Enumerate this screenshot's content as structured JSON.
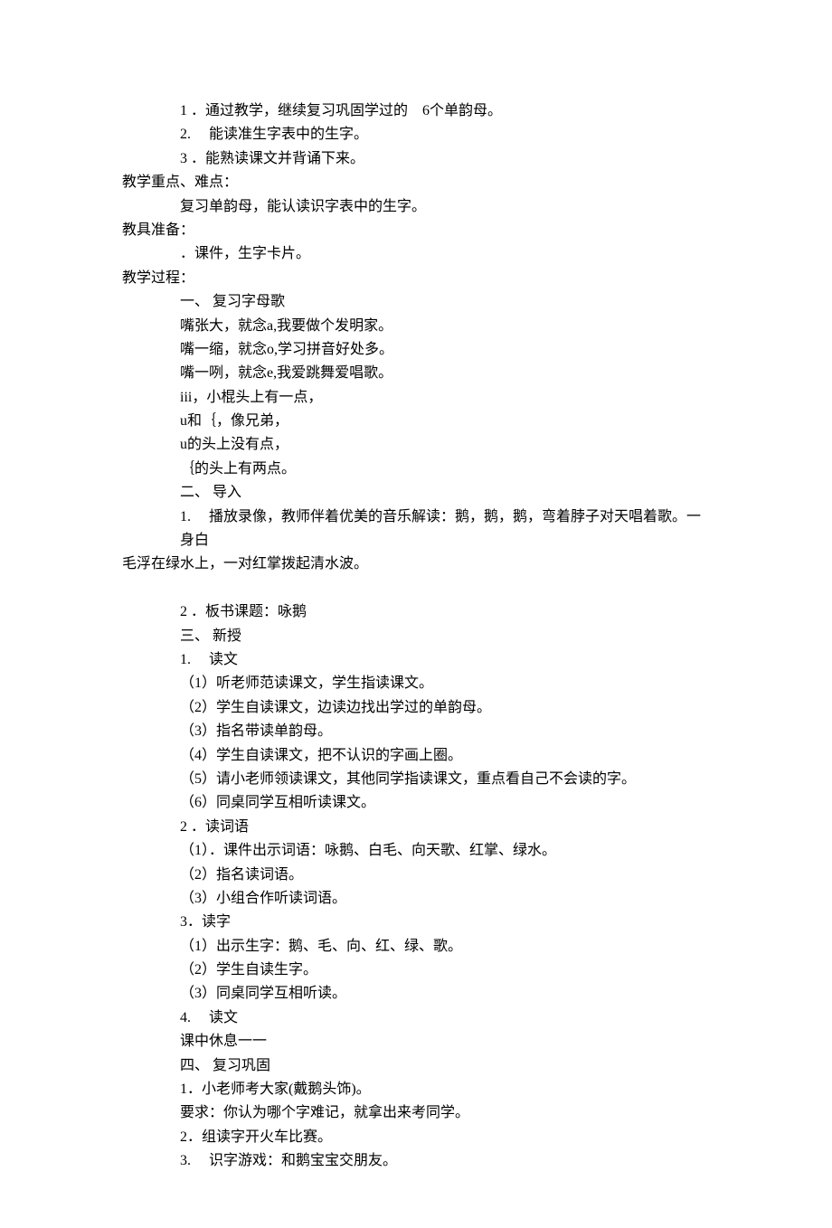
{
  "lines": [
    {
      "cls": "indent-2",
      "text": "1 ．通过教学，继续复习巩固学过的　6个单韵母。"
    },
    {
      "cls": "indent-2",
      "text": "2.　 能读准生字表中的生字。"
    },
    {
      "cls": "indent-2",
      "text": "3 ．能熟读课文并背诵下来。"
    },
    {
      "cls": "",
      "text": "教学重点、难点："
    },
    {
      "cls": "indent-2",
      "text": "复习单韵母，能认读识字表中的生字。"
    },
    {
      "cls": "",
      "text": "教具准备："
    },
    {
      "cls": "indent-2",
      "text": "．课件，生字卡片。"
    },
    {
      "cls": "",
      "text": "教学过程："
    },
    {
      "cls": "indent-2",
      "text": "一、 复习字母歌"
    },
    {
      "cls": "indent-2",
      "text": "嘴张大，就念a,我要做个发明家。"
    },
    {
      "cls": "indent-2",
      "text": "嘴一缩，就念o,学习拼音好处多。"
    },
    {
      "cls": "indent-2",
      "text": "嘴一咧，就念e,我爱跳舞爱唱歌。"
    },
    {
      "cls": "indent-2",
      "text": "iii，小棍头上有一点，"
    },
    {
      "cls": "indent-2",
      "text": "u和｛，像兄弟，"
    },
    {
      "cls": "indent-2",
      "text": "u的头上没有点，"
    },
    {
      "cls": "indent-2",
      "text": "｛的头上有两点。"
    },
    {
      "cls": "indent-2",
      "text": "二、 导入"
    },
    {
      "cls": "indent-2",
      "text": "1.　 播放录像，教师伴着优美的音乐解读：鹅，鹅，鹅，弯着脖子对天唱着歌。一身白"
    },
    {
      "cls": "",
      "text": "毛浮在绿水上，一对红掌拨起清水波。"
    },
    {
      "cls": "blank",
      "text": ""
    },
    {
      "cls": "indent-2",
      "text": "2 ．板书课题：咏鹅"
    },
    {
      "cls": "indent-2",
      "text": "三、 新授"
    },
    {
      "cls": "indent-2",
      "text": "1.　 读文"
    },
    {
      "cls": "indent-2",
      "text": "（1）听老师范读课文，学生指读课文。"
    },
    {
      "cls": "indent-2",
      "text": "（2）学生自读课文，边读边找出学过的单韵母。"
    },
    {
      "cls": "indent-2",
      "text": "（3）指名带读单韵母。"
    },
    {
      "cls": "indent-2",
      "text": "（4）学生自读课文，把不认识的字画上圈。"
    },
    {
      "cls": "indent-2",
      "text": "（5）请小老师领读课文，其他同学指读课文，重点看自己不会读的字。"
    },
    {
      "cls": "indent-2",
      "text": "（6）同桌同学互相听读课文。"
    },
    {
      "cls": "indent-2",
      "text": "2 ．读词语"
    },
    {
      "cls": "indent-2",
      "text": "（1）．课件出示词语：咏鹅、白毛、向天歌、红掌、绿水。"
    },
    {
      "cls": "indent-2",
      "text": "（2）指名读词语。"
    },
    {
      "cls": "indent-2",
      "text": "（3）小组合作听读词语。"
    },
    {
      "cls": "indent-2",
      "text": "3．读字"
    },
    {
      "cls": "indent-2",
      "text": "（1）出示生字：鹅、毛、向、红、绿、歌。"
    },
    {
      "cls": "indent-2",
      "text": "（2）学生自读生字。"
    },
    {
      "cls": "indent-2",
      "text": "（3）同桌同学互相听读。"
    },
    {
      "cls": "indent-2",
      "text": "4.　 读文"
    },
    {
      "cls": "indent-2",
      "text": "课中休息一一"
    },
    {
      "cls": "indent-2",
      "text": "四、 复习巩固"
    },
    {
      "cls": "indent-2",
      "text": "1．小老师考大家(戴鹅头饰)。"
    },
    {
      "cls": "indent-2",
      "text": "要求：你认为哪个字难记，就拿出来考同学。"
    },
    {
      "cls": "indent-2",
      "text": "2．组读字开火车比赛。"
    },
    {
      "cls": "indent-2",
      "text": "3.　 识字游戏：和鹅宝宝交朋友。"
    }
  ]
}
